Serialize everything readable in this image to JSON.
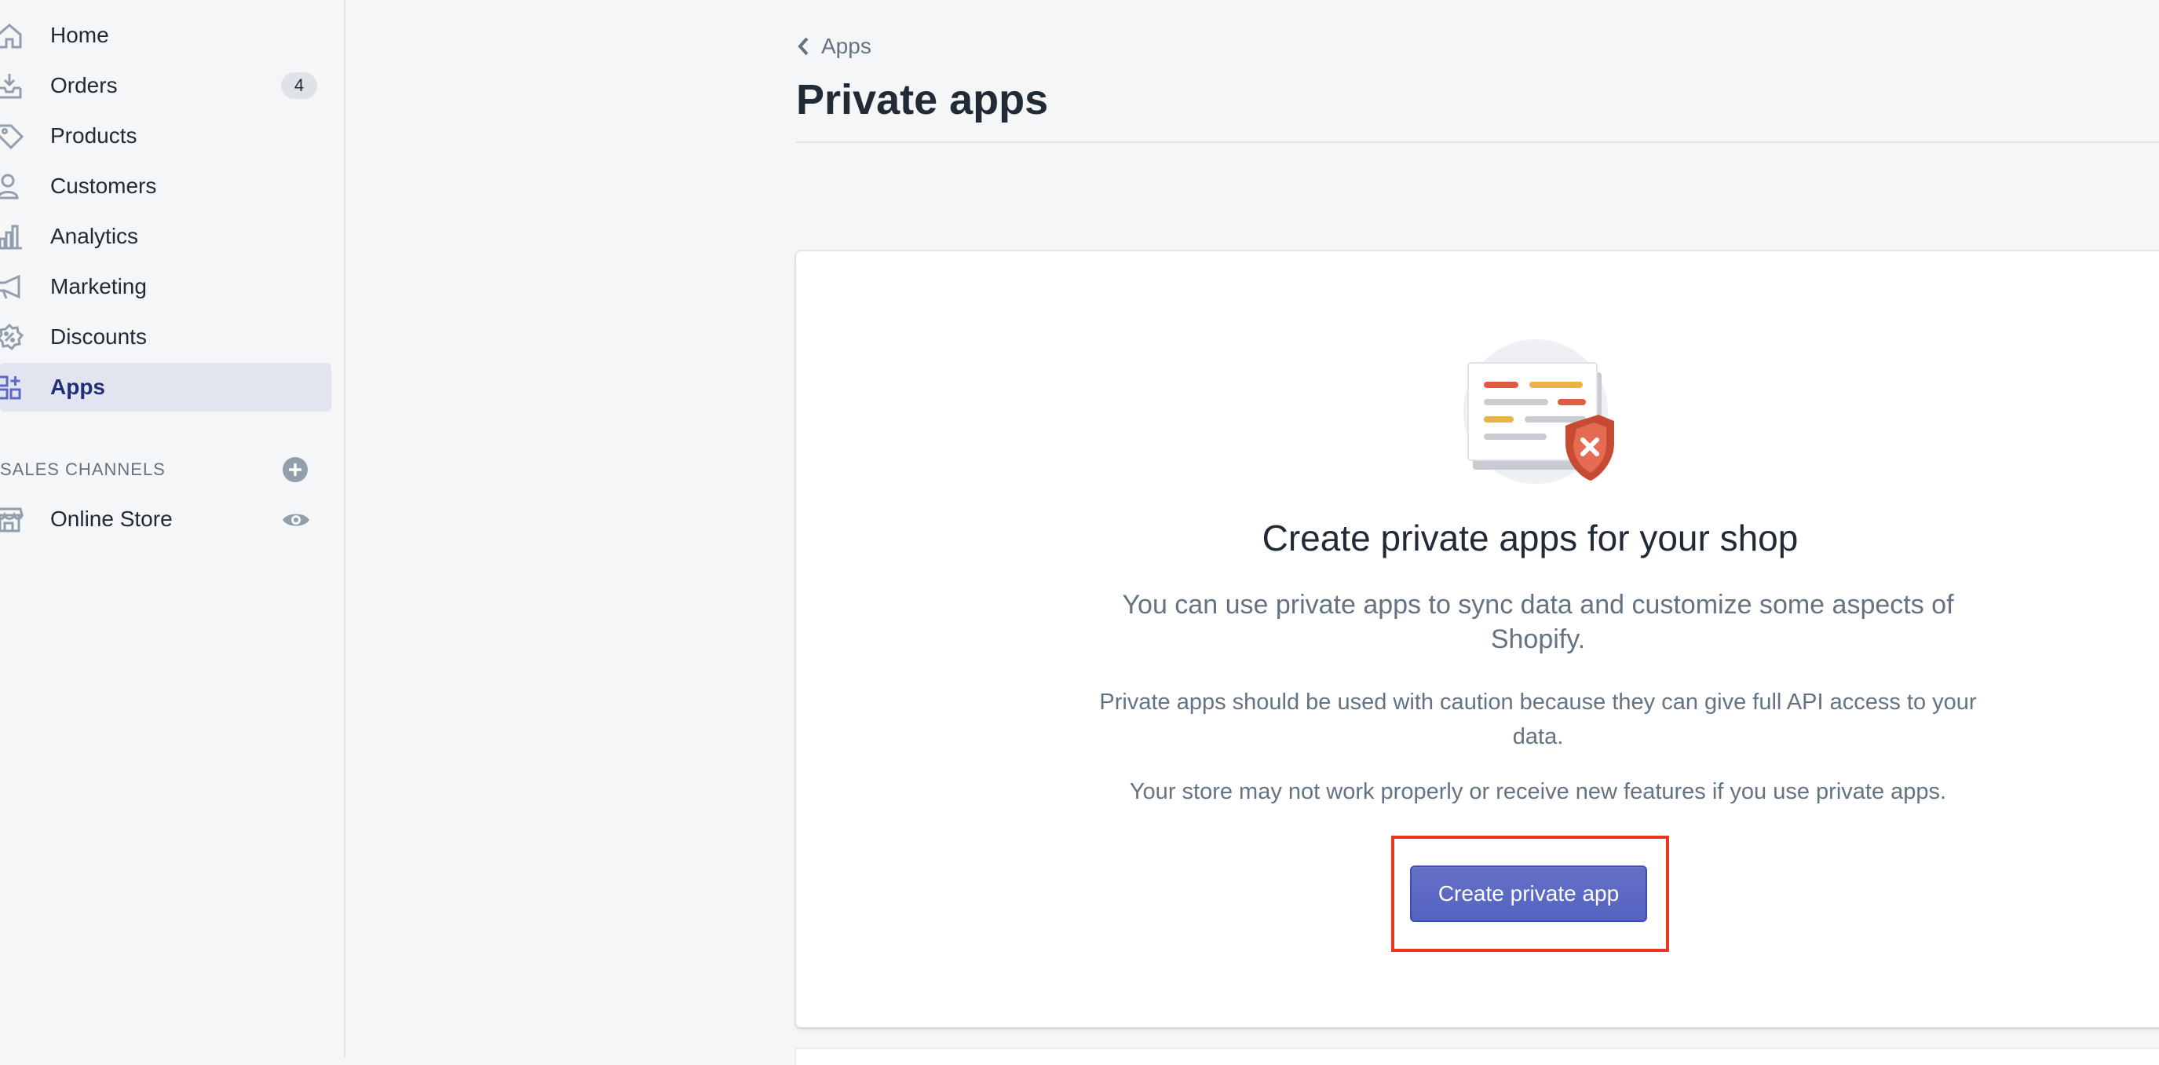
{
  "sidebar": {
    "items": [
      {
        "label": "Home",
        "icon": "home-icon"
      },
      {
        "label": "Orders",
        "icon": "orders-icon",
        "badge": "4"
      },
      {
        "label": "Products",
        "icon": "tag-icon"
      },
      {
        "label": "Customers",
        "icon": "customer-icon"
      },
      {
        "label": "Analytics",
        "icon": "analytics-icon"
      },
      {
        "label": "Marketing",
        "icon": "megaphone-icon"
      },
      {
        "label": "Discounts",
        "icon": "discount-icon"
      },
      {
        "label": "Apps",
        "icon": "apps-icon",
        "active": true
      }
    ],
    "sales_channels": {
      "heading": "SALES CHANNELS",
      "items": [
        {
          "label": "Online Store",
          "icon": "store-icon"
        }
      ]
    }
  },
  "main": {
    "breadcrumb": "Apps",
    "title": "Private apps",
    "card": {
      "heading": "Create private apps for your shop",
      "subheading": "You can use private apps to sync data and customize some aspects of Shopify.",
      "caution": "Private apps should be used with caution because they can give full API access to your data.",
      "warning": "Your store may not work properly or receive new features if you use private apps.",
      "button_label": "Create private app"
    }
  },
  "colors": {
    "accent": "#5c6ac4",
    "active_nav_bg": "#e2e4f0",
    "highlight": "#e8361f",
    "muted_text": "#637381"
  }
}
